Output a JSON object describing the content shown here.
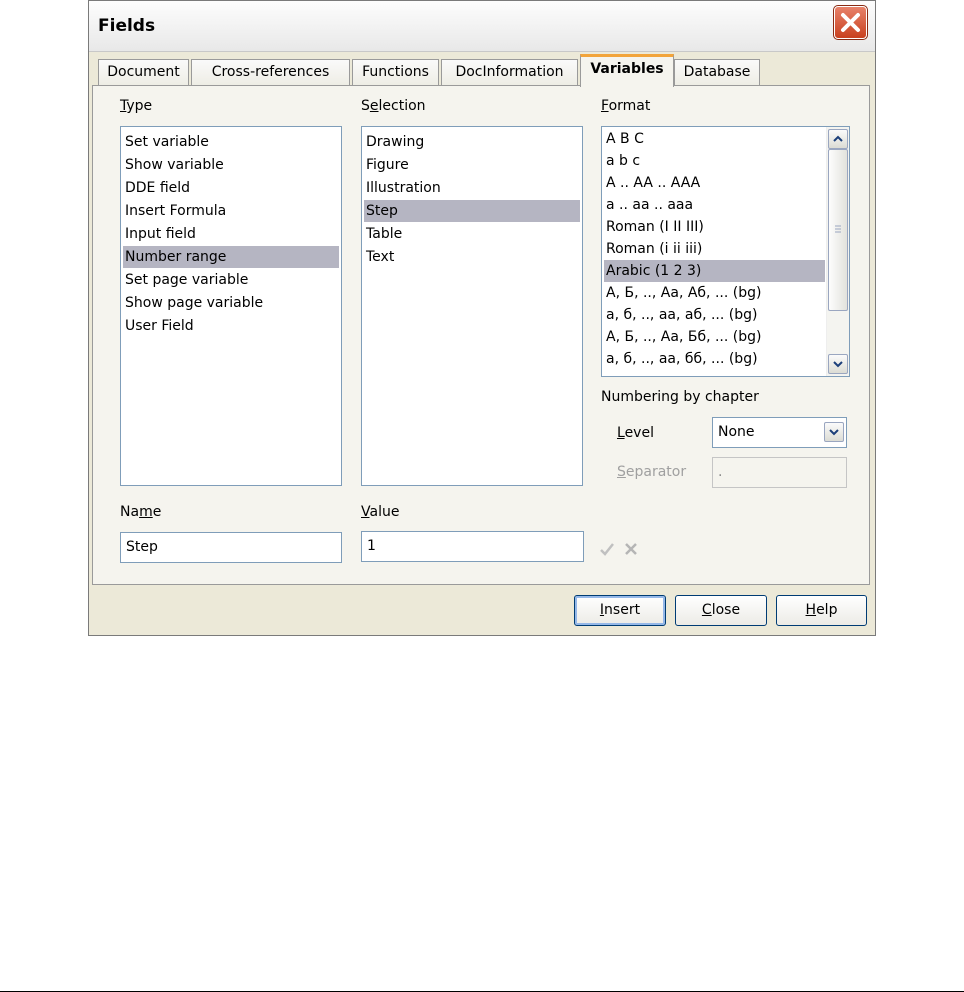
{
  "window": {
    "title": "Fields"
  },
  "tabs": [
    {
      "label": "Document"
    },
    {
      "label": "Cross-references"
    },
    {
      "label": "Functions"
    },
    {
      "label": "DocInformation"
    },
    {
      "label": "Variables",
      "active": true
    },
    {
      "label": "Database"
    }
  ],
  "type": {
    "label_first": "T",
    "label_rest": "ype",
    "items": [
      "Set variable",
      "Show variable",
      "DDE field",
      "Insert Formula",
      "Input field",
      "Number range",
      "Set page variable",
      "Show page variable",
      "User Field"
    ],
    "selected": "Number range"
  },
  "selection": {
    "label_first": "S",
    "label_u": "e",
    "label_rest": "lection",
    "items": [
      "Drawing",
      "Figure",
      "Illustration",
      "Step",
      "Table",
      "Text"
    ],
    "selected": "Step"
  },
  "format": {
    "label_u": "F",
    "label_rest": "ormat",
    "items": [
      "A B C",
      "a b c",
      "A .. AA .. AAA",
      "a .. aa .. aaa",
      "Roman (I II III)",
      "Roman (i ii iii)",
      "Arabic (1 2 3)",
      "А, Б, .., Аа, Аб, ... (bg)",
      "а, б, .., аа, аб, ... (bg)",
      "А, Б, .., Аа, Бб, ... (bg)",
      "а, б, .., аа, бб, ... (bg)"
    ],
    "selected": "Arabic (1 2 3)"
  },
  "numbering": {
    "heading": "Numbering by chapter",
    "level_label_u": "L",
    "level_label_rest": "evel",
    "level_value": "None",
    "separator_label_u": "S",
    "separator_label_rest": "eparator",
    "separator_value": "."
  },
  "name": {
    "label_first": "Na",
    "label_u": "m",
    "label_rest": "e",
    "value": "Step"
  },
  "value": {
    "label_u": "V",
    "label_rest": "alue",
    "value": "1"
  },
  "buttons": {
    "insert_u": "I",
    "insert_rest": "nsert",
    "close_u": "C",
    "close_rest": "lose",
    "help_u": "H",
    "help_rest": "elp"
  },
  "colors": {
    "selection": "#b5b5c2",
    "active_tab_accent": "#f2a43a",
    "close_button": "#c9401f"
  }
}
